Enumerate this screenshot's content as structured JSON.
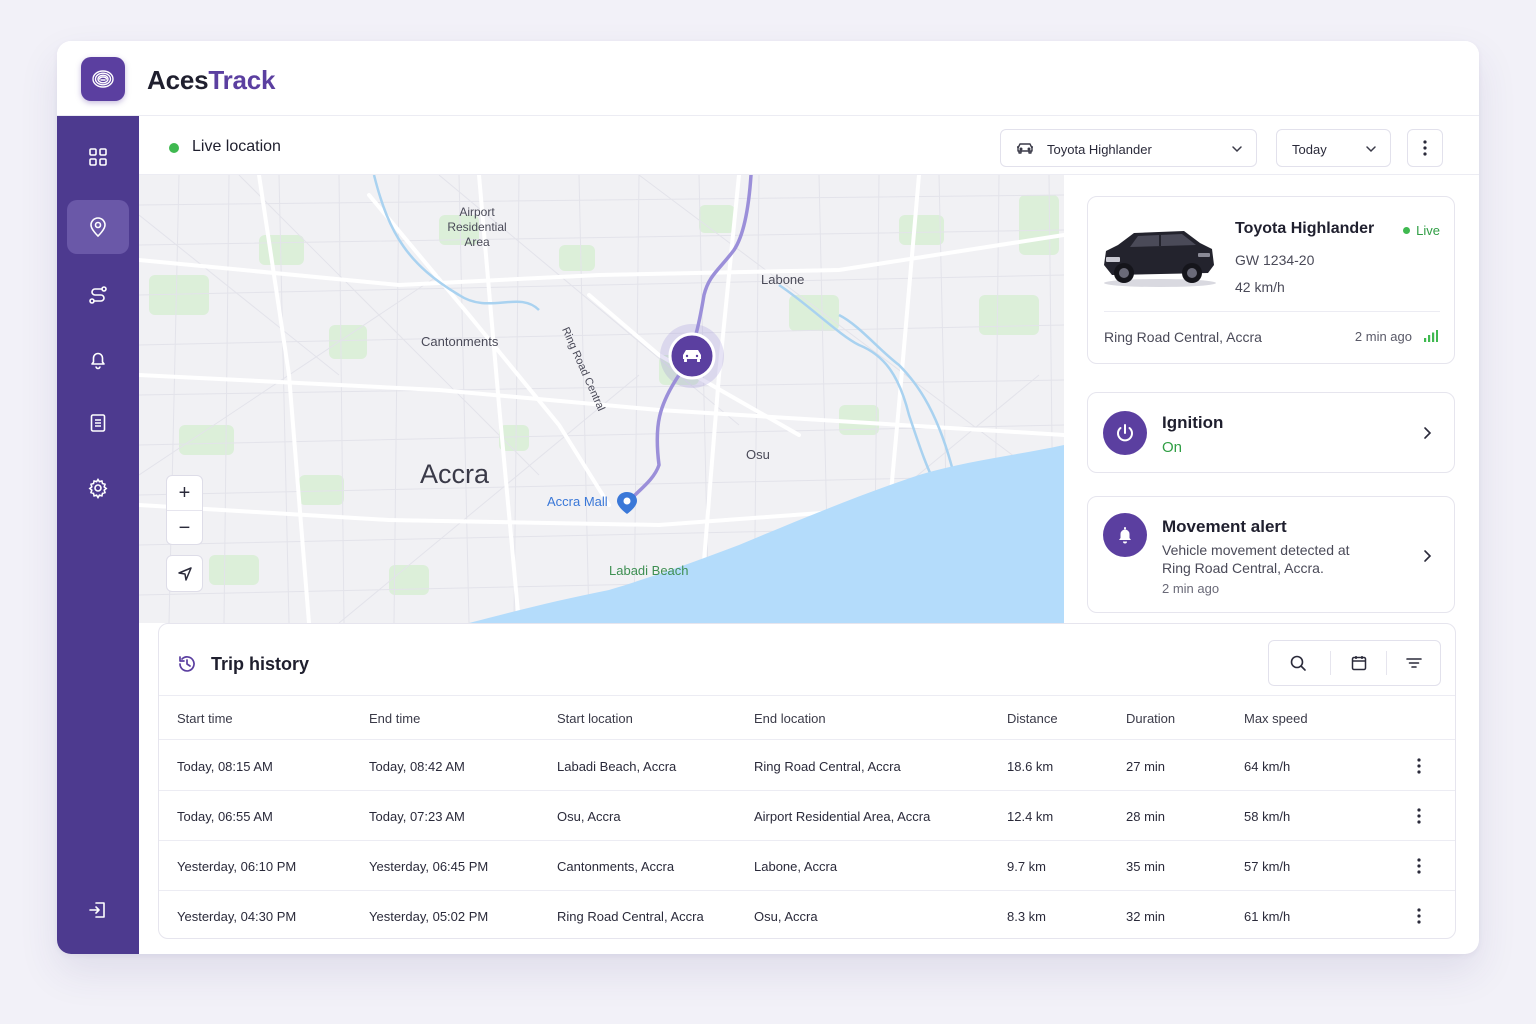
{
  "app": {
    "brand_part1": "Aces",
    "brand_part2": "Track",
    "logo_icon": "fingerprint-icon",
    "accent_color": "#5b3fa0",
    "sidebar_color": "#4d3a8f"
  },
  "sidebar": {
    "items": [
      {
        "name": "dashboard",
        "icon": "grid-icon",
        "active": false
      },
      {
        "name": "live-location",
        "icon": "location-pin-icon",
        "active": true
      },
      {
        "name": "routes",
        "icon": "route-icon",
        "active": false
      },
      {
        "name": "alerts",
        "icon": "bell-icon",
        "active": false
      },
      {
        "name": "reports",
        "icon": "document-icon",
        "active": false
      },
      {
        "name": "settings",
        "icon": "gear-icon",
        "active": false
      }
    ],
    "logout_icon": "logout-icon"
  },
  "subheader": {
    "title": "Live location",
    "vehicle_select": "Toyota Highlander",
    "date_select": "Today"
  },
  "map": {
    "labels": {
      "airport": "Airport\nResidential\nArea",
      "labone": "Labone",
      "cantonments": "Cantonments",
      "ring_road": "Ring Road Central",
      "osu": "Osu",
      "accra": "Accra",
      "accra_mall": "Accra Mall",
      "labadi": "Labadi Beach"
    },
    "zoom_in": "+",
    "zoom_out": "−"
  },
  "vehicle": {
    "name": "Toyota Highlander",
    "status": "Live",
    "plate": "GW 1234-20",
    "speed": "42 km/h",
    "location": "Ring Road Central, Accra",
    "updated": "2 min ago"
  },
  "ignition": {
    "title": "Ignition",
    "state": "On"
  },
  "movement_alert": {
    "title": "Movement alert",
    "description": "Vehicle movement detected at Ring Road Central, Accra.",
    "time": "2 min ago"
  },
  "trips": {
    "title": "Trip history",
    "columns": [
      "Start time",
      "End time",
      "Start location",
      "End location",
      "Distance",
      "Duration",
      "Max speed"
    ],
    "rows": [
      [
        "Today, 08:15 AM",
        "Today, 08:42 AM",
        "Labadi Beach, Accra",
        "Ring Road Central, Accra",
        "18.6 km",
        "27 min",
        "64 km/h"
      ],
      [
        "Today, 06:55 AM",
        "Today, 07:23 AM",
        "Osu, Accra",
        "Airport Residential Area, Accra",
        "12.4 km",
        "28 min",
        "58 km/h"
      ],
      [
        "Yesterday, 06:10 PM",
        "Yesterday, 06:45 PM",
        "Cantonments, Accra",
        "Labone, Accra",
        "9.7 km",
        "35 min",
        "57 km/h"
      ],
      [
        "Yesterday, 04:30 PM",
        "Yesterday, 05:02 PM",
        "Ring Road Central, Accra",
        "Osu, Accra",
        "8.3 km",
        "32 min",
        "61 km/h"
      ]
    ]
  }
}
